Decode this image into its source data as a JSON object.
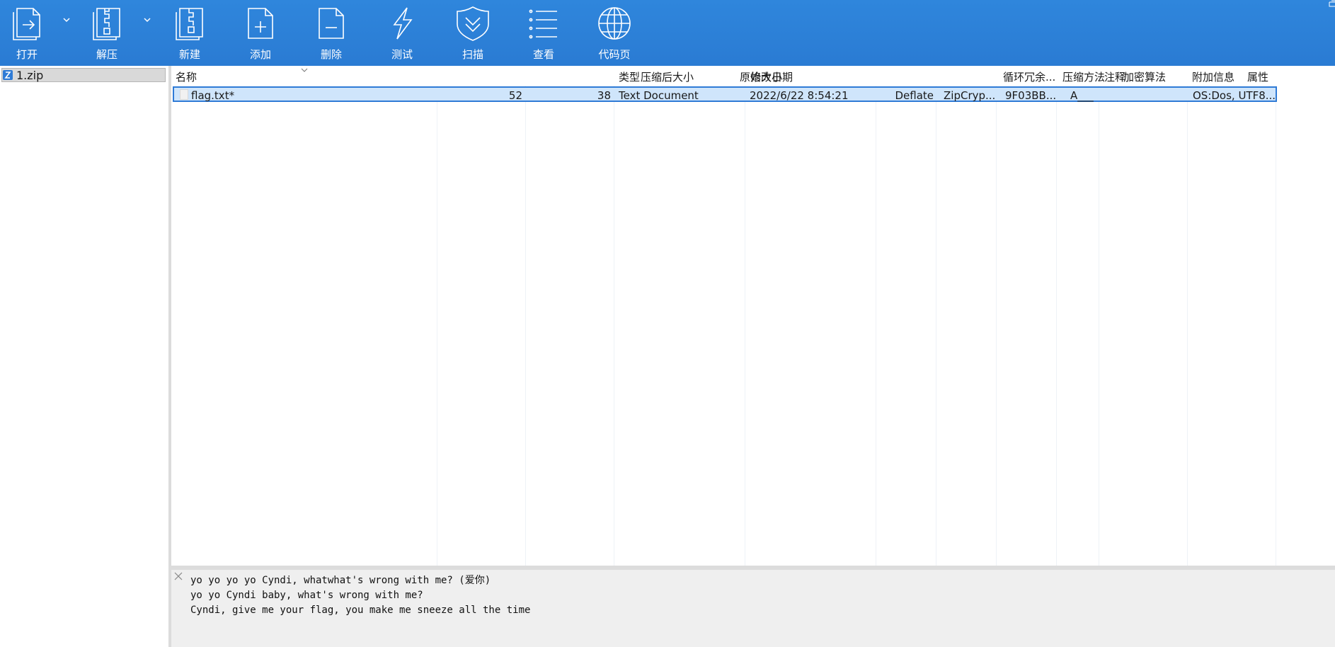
{
  "toolbar": {
    "buttons": [
      {
        "label": "打开",
        "icon": "open-icon"
      },
      {
        "label": "解压",
        "icon": "extract-icon"
      },
      {
        "label": "新建",
        "icon": "new-archive-icon"
      },
      {
        "label": "添加",
        "icon": "add-file-icon"
      },
      {
        "label": "删除",
        "icon": "delete-file-icon"
      },
      {
        "label": "测试",
        "icon": "test-lightning-icon"
      },
      {
        "label": "扫描",
        "icon": "scan-shield-icon"
      },
      {
        "label": "查看",
        "icon": "view-list-icon"
      },
      {
        "label": "代码页",
        "icon": "codepage-globe-icon"
      }
    ],
    "background": "#2f86dc"
  },
  "tree": {
    "items": [
      {
        "label": "1.zip",
        "icon": "zip-archive-icon"
      }
    ]
  },
  "table": {
    "columns": [
      "名称",
      "压缩后大小",
      "原始大小",
      "类型",
      "修改日期",
      "压缩方法",
      "加密算法",
      "循环冗余...",
      "属性",
      "注释",
      "附加信息"
    ],
    "rows": [
      {
        "name": "flag.txt*",
        "packed": "52",
        "size": "38",
        "type": "Text Document",
        "modified": "2022/6/22 8:54:21",
        "method": "Deflate",
        "encryption": "ZipCryp...",
        "crc": "9F03BB...",
        "attributes": "A___",
        "comment": "",
        "extra": "OS:Dos, UTF8..."
      }
    ],
    "selection_color": "#cfe5fb"
  },
  "comment_panel": {
    "lines": [
      "yo yo yo yo Cyndi, whatwhat's wrong with me? (爱你)",
      "yo yo Cyndi baby, what's wrong with me?",
      "Cyndi, give me your flag, you make me sneeze all the time"
    ]
  }
}
